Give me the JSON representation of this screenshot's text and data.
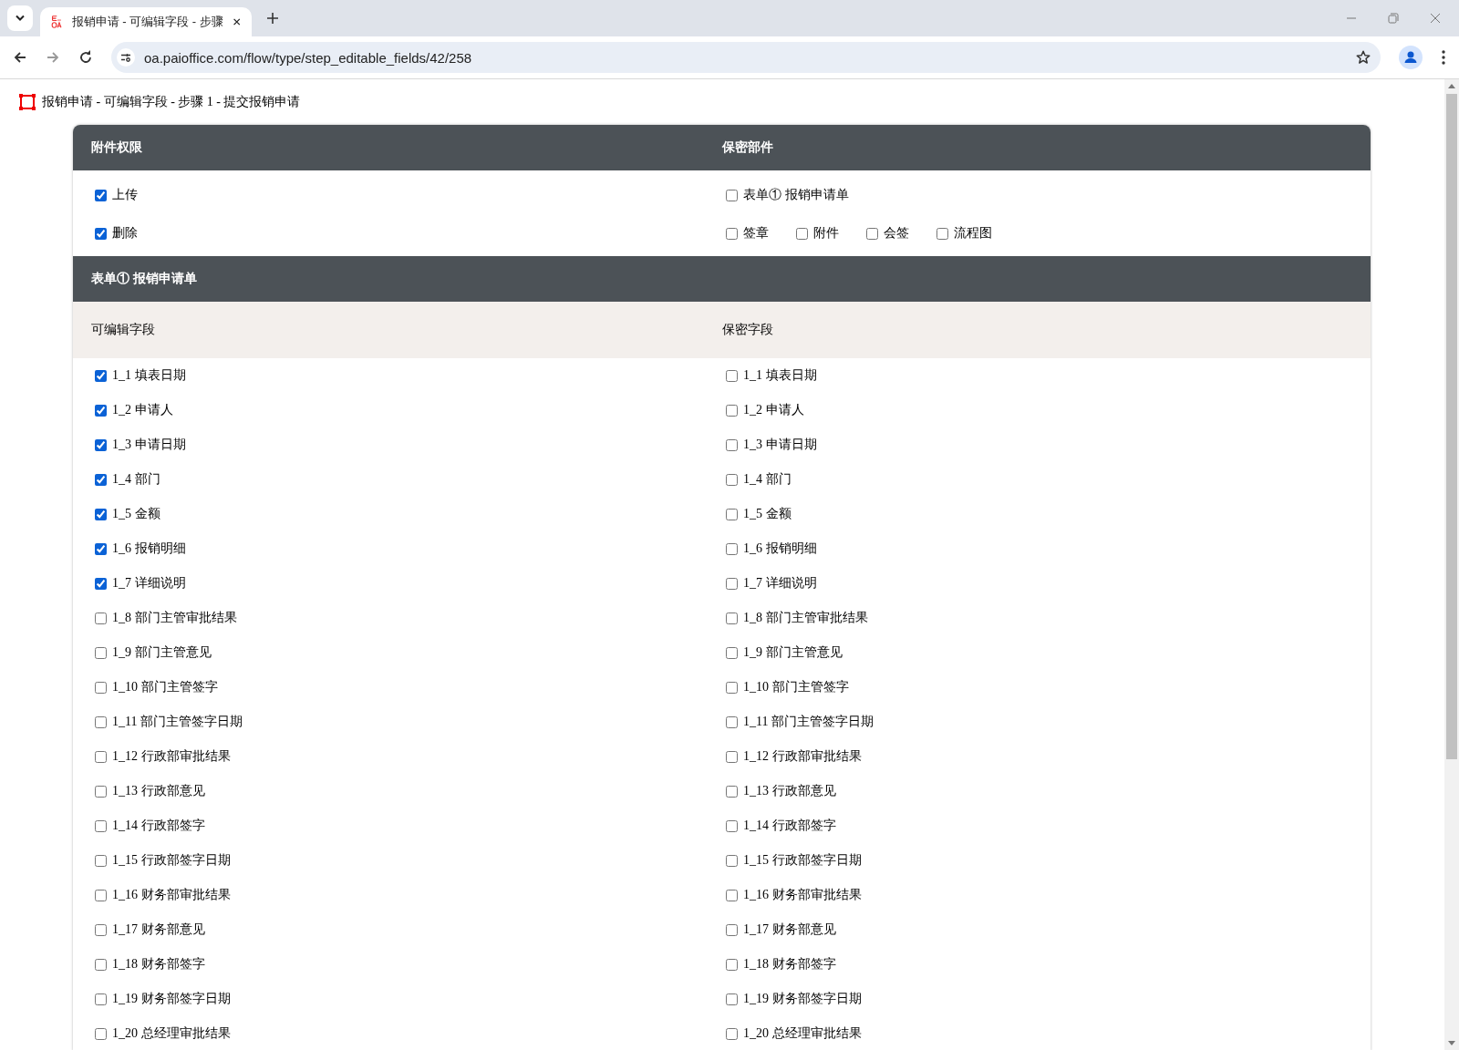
{
  "browser": {
    "tab_title": "报销申请 - 可编辑字段 - 步骤",
    "url": "oa.paioffice.com/flow/type/step_editable_fields/42/258"
  },
  "page_title": "报销申请 - 可编辑字段 - 步骤 1 - 提交报销申请",
  "attachment_panel": {
    "left_heading": "附件权限",
    "right_heading": "保密部件",
    "permissions": [
      {
        "label": "上传",
        "checked": true
      },
      {
        "label": "删除",
        "checked": true
      }
    ],
    "secret_form": {
      "label": "表单① 报销申请单",
      "checked": false
    },
    "secret_parts": [
      {
        "label": "签章",
        "checked": false
      },
      {
        "label": "附件",
        "checked": false
      },
      {
        "label": "会签",
        "checked": false
      },
      {
        "label": "流程图",
        "checked": false
      }
    ]
  },
  "form_section": {
    "title": "表单① 报销申请单",
    "editable_heading": "可编辑字段",
    "secret_heading": "保密字段",
    "rows": [
      {
        "editable": {
          "label": "1_1 填表日期",
          "checked": true
        },
        "secret": {
          "label": "1_1 填表日期",
          "checked": false
        }
      },
      {
        "editable": {
          "label": "1_2 申请人",
          "checked": true
        },
        "secret": {
          "label": "1_2 申请人",
          "checked": false
        }
      },
      {
        "editable": {
          "label": "1_3 申请日期",
          "checked": true
        },
        "secret": {
          "label": "1_3 申请日期",
          "checked": false
        }
      },
      {
        "editable": {
          "label": "1_4 部门",
          "checked": true
        },
        "secret": {
          "label": "1_4 部门",
          "checked": false
        }
      },
      {
        "editable": {
          "label": "1_5 金额",
          "checked": true
        },
        "secret": {
          "label": "1_5 金额",
          "checked": false
        }
      },
      {
        "editable": {
          "label": "1_6 报销明细",
          "checked": true
        },
        "secret": {
          "label": "1_6 报销明细",
          "checked": false
        }
      },
      {
        "editable": {
          "label": "1_7 详细说明",
          "checked": true
        },
        "secret": {
          "label": "1_7 详细说明",
          "checked": false
        }
      },
      {
        "editable": {
          "label": "1_8 部门主管审批结果",
          "checked": false
        },
        "secret": {
          "label": "1_8 部门主管审批结果",
          "checked": false
        }
      },
      {
        "editable": {
          "label": "1_9 部门主管意见",
          "checked": false
        },
        "secret": {
          "label": "1_9 部门主管意见",
          "checked": false
        }
      },
      {
        "editable": {
          "label": "1_10 部门主管签字",
          "checked": false
        },
        "secret": {
          "label": "1_10 部门主管签字",
          "checked": false
        }
      },
      {
        "editable": {
          "label": "1_11 部门主管签字日期",
          "checked": false
        },
        "secret": {
          "label": "1_11 部门主管签字日期",
          "checked": false
        }
      },
      {
        "editable": {
          "label": "1_12 行政部审批结果",
          "checked": false
        },
        "secret": {
          "label": "1_12 行政部审批结果",
          "checked": false
        }
      },
      {
        "editable": {
          "label": "1_13 行政部意见",
          "checked": false
        },
        "secret": {
          "label": "1_13 行政部意见",
          "checked": false
        }
      },
      {
        "editable": {
          "label": "1_14 行政部签字",
          "checked": false
        },
        "secret": {
          "label": "1_14 行政部签字",
          "checked": false
        }
      },
      {
        "editable": {
          "label": "1_15 行政部签字日期",
          "checked": false
        },
        "secret": {
          "label": "1_15 行政部签字日期",
          "checked": false
        }
      },
      {
        "editable": {
          "label": "1_16 财务部审批结果",
          "checked": false
        },
        "secret": {
          "label": "1_16 财务部审批结果",
          "checked": false
        }
      },
      {
        "editable": {
          "label": "1_17 财务部意见",
          "checked": false
        },
        "secret": {
          "label": "1_17 财务部意见",
          "checked": false
        }
      },
      {
        "editable": {
          "label": "1_18 财务部签字",
          "checked": false
        },
        "secret": {
          "label": "1_18 财务部签字",
          "checked": false
        }
      },
      {
        "editable": {
          "label": "1_19 财务部签字日期",
          "checked": false
        },
        "secret": {
          "label": "1_19 财务部签字日期",
          "checked": false
        }
      },
      {
        "editable": {
          "label": "1_20 总经理审批结果",
          "checked": false
        },
        "secret": {
          "label": "1_20 总经理审批结果",
          "checked": false
        }
      }
    ]
  }
}
